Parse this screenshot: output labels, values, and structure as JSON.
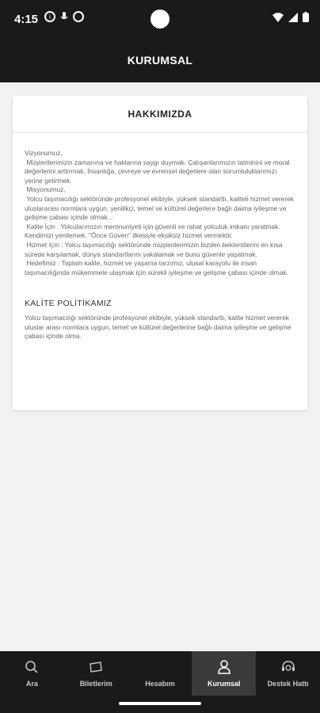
{
  "status": {
    "time": "4:15"
  },
  "appbar": {
    "title": "KURUMSAL"
  },
  "card": {
    "header": "HAKKIMIZDA",
    "vision": "Vizyonumuz,\n Müşterilerimizin zamanına ve haklarına saygı duymak. Çalışanlarımızın tatminini ve moral değerlerini arttırmak, İnsanlığa, çevreye ve evrensel değerlere olan sorumluluklarımızı yerine getirmek.\n Misyonumuz,\n Yolcu taşımacılığı sektöründe profesyonel ekibiyle, yüksek standartlı, kaliteli hizmet vererek uluslararası normlara uygun, yenilikçi, temel ve kültürel değerlere bağlı daima iyileşme ve gelişme çabası içinde olmak...\n Kalite İçin : Yolcularımızın memnuniyeti için güvenli ve rahat yolculuk imkanı yaratmak. Kendimizi yenilemek. \"Önce Güven\" ilkesiyle eksiksiz hizmet vermektir.\n Hizmet İçin : Yolcu taşımacılığı sektöründe müşterilerimizin bizden beklentilerini en kısa sürede karşılamak, dünya standartlarını yakalamak ve bunu güvenle yaşatmak.\n Hedefimiz : Toplam kalite, hizmet ve yaşama tarzımız, ulusal karayolu ile insan taşımacılığında mükemmele ulaşmak için sürekli iyileşme ve gelişme çabası içinde olmak.",
    "policy_title": "KALİTE POLİTİKAMIZ",
    "policy_text": "Yolcu taşımacılığı sektöründe profesyonel ekibiyle, yüksek standartlı, kalite hizmet vererek uluslar arası normlara uygun, temel ve kültürel değerlerine bağlı daima iyileşme ve gelişme çabası içinde olma."
  },
  "nav": {
    "items": [
      {
        "label": "Ara",
        "icon": "search-icon"
      },
      {
        "label": "Biletlerim",
        "icon": "ticket-icon"
      },
      {
        "label": "Hesabım",
        "icon": "account-icon"
      },
      {
        "label": "Kurumsal",
        "icon": "corporate-icon"
      },
      {
        "label": "Destek Hattı",
        "icon": "support-icon"
      }
    ],
    "active_index": 3
  },
  "colors": {
    "bar_bg": "#1a1a1a",
    "active_tab": "#3a3a3a",
    "page_bg": "#f2f2f2"
  }
}
